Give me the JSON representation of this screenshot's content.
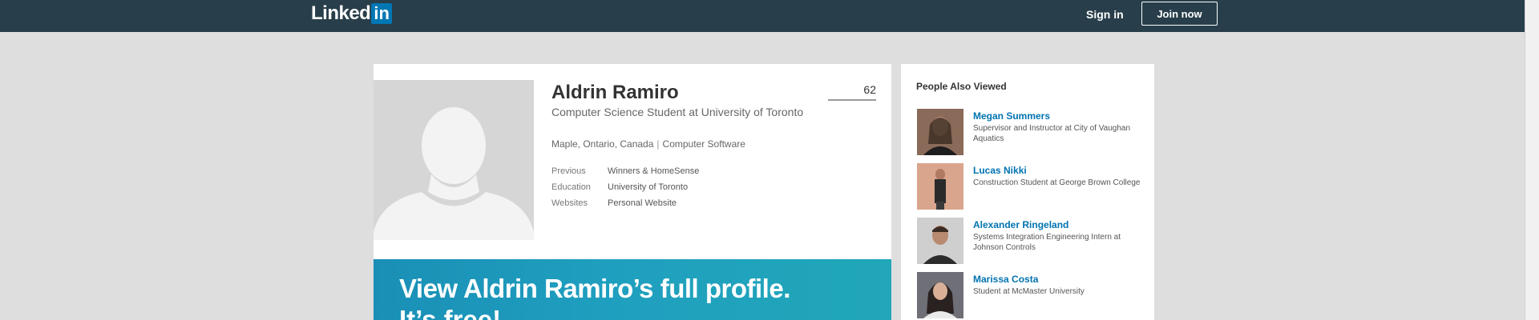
{
  "nav": {
    "logo_word": "Linked",
    "logo_in": "in",
    "sign_in": "Sign in",
    "join_now": "Join now",
    "bar_color": "#283e4a"
  },
  "profile": {
    "name": "Aldrin Ramiro",
    "headline": "Computer Science Student at University of Toronto",
    "location": "Maple, Ontario, Canada",
    "industry": "Computer Software",
    "connections": "62",
    "facts": [
      {
        "label": "Previous",
        "value": "Winners & HomeSense"
      },
      {
        "label": "Education",
        "value": "University of Toronto"
      },
      {
        "label": "Websites",
        "value": "Personal Website"
      }
    ],
    "banner_line1": "View Aldrin Ramiro’s full profile.",
    "banner_line2": "It’s free!"
  },
  "people_also_viewed": {
    "title": "People Also Viewed",
    "people": [
      {
        "name": "Megan Summers",
        "description": "Supervisor and Instructor at City of Vaughan Aquatics",
        "photo": "person-photo"
      },
      {
        "name": "Lucas Nikki",
        "description": "Construction Student at George Brown College",
        "photo": "person-photo"
      },
      {
        "name": "Alexander Ringeland",
        "description": "Systems Integration Engineering Intern at Johnson Controls",
        "photo": "person-photo"
      },
      {
        "name": "Marissa Costa",
        "description": "Student at McMaster University",
        "photo": "person-photo"
      }
    ]
  },
  "colors": {
    "link": "#0073b1",
    "banner": "#1f9fbf",
    "background": "#dedede"
  }
}
